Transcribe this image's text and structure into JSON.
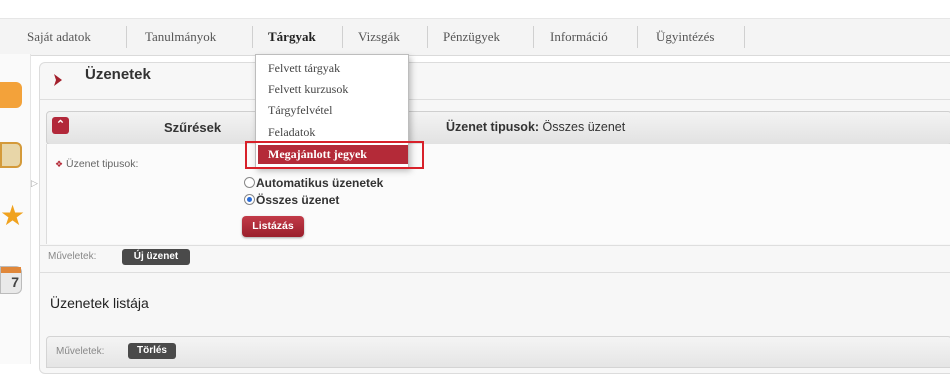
{
  "menu": {
    "items": [
      "Saját adatok",
      "Tanulmányok",
      "Tárgyak",
      "Vizsgák",
      "Pénzügyek",
      "Információ",
      "Ügyintézés"
    ],
    "active_index": 2
  },
  "dropdown": {
    "items": [
      "Felvett tárgyak",
      "Felvett kurzusok",
      "Tárgyfelvétel",
      "Feladatok",
      "Megajánlott jegyek"
    ],
    "highlighted": "Megajánlott jegyek"
  },
  "panel": {
    "title": "Üzenetek"
  },
  "filter": {
    "header": "Szűrések",
    "summary_label": "Üzenet tipusok:",
    "summary_value": "Összes üzenet",
    "field_label": "Üzenet tipusok:",
    "options": [
      {
        "label": "Automatikus üzenetek",
        "selected": false
      },
      {
        "label": "Összes üzenet",
        "selected": true
      }
    ],
    "submit": "Listázás"
  },
  "actions": {
    "label": "Műveletek:",
    "new_button": "Új üzenet"
  },
  "list": {
    "title": "Üzenetek listája",
    "actions_label": "Műveletek:",
    "delete_button": "Törlés"
  },
  "colors": {
    "accent": "#b42a38",
    "highlight_border": "#d8212a"
  }
}
